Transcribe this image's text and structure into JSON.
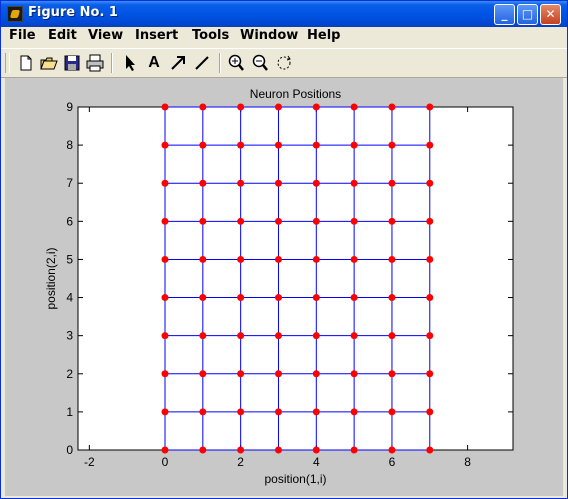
{
  "window": {
    "title": "Figure No. 1",
    "controls": {
      "minimize": "_",
      "maximize": "□",
      "close": "✕"
    }
  },
  "menu": [
    "File",
    "Edit",
    "View",
    "Insert",
    "Tools",
    "Window",
    "Help"
  ],
  "toolbar": {
    "icons": [
      "new-figure-icon",
      "open-file-icon",
      "save-icon",
      "print-icon",
      "select-arrow-icon",
      "insert-text-icon",
      "insert-arrow-icon",
      "insert-line-icon",
      "zoom-in-icon",
      "zoom-out-icon",
      "rotate-3d-icon"
    ],
    "text_tool_label": "A"
  },
  "chart_data": {
    "type": "scatter",
    "title": "Neuron Positions",
    "xlabel": "position(1,i)",
    "ylabel": "position(2,i)",
    "xlim": [
      -2.3,
      9.2
    ],
    "ylim": [
      0,
      9
    ],
    "xticks": [
      -2,
      0,
      2,
      4,
      6,
      8
    ],
    "yticks": [
      0,
      1,
      2,
      3,
      4,
      5,
      6,
      7,
      8,
      9
    ],
    "grid_x": [
      0,
      1,
      2,
      3,
      4,
      5,
      6,
      7
    ],
    "grid_y": [
      0,
      1,
      2,
      3,
      4,
      5,
      6,
      7,
      8,
      9
    ],
    "point_color": "#ff0000",
    "line_color": "#0000ff",
    "grid": false
  }
}
